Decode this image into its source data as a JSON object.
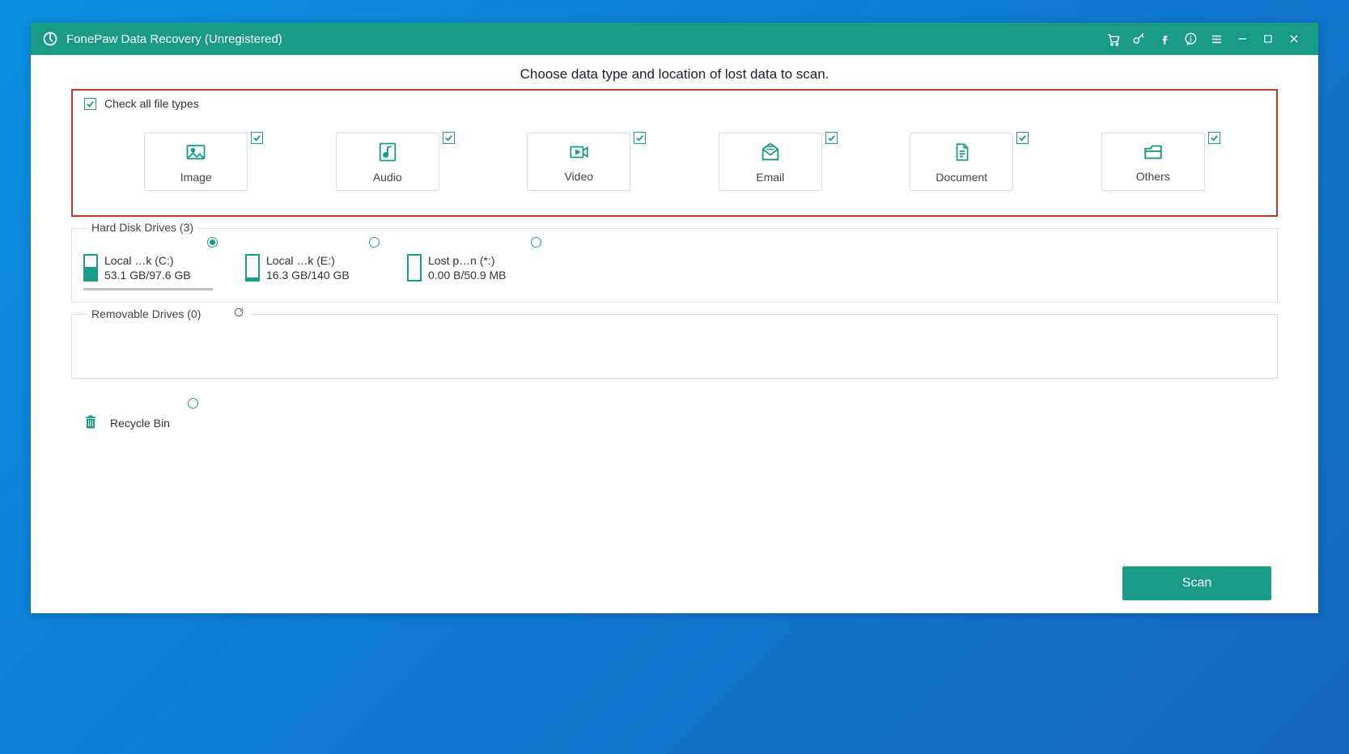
{
  "window": {
    "title": "FonePaw Data Recovery (Unregistered)"
  },
  "instruction": "Choose data type and location of lost data to scan.",
  "checkAll": {
    "label": "Check all file types",
    "checked": true
  },
  "types": [
    {
      "key": "image",
      "label": "Image",
      "checked": true
    },
    {
      "key": "audio",
      "label": "Audio",
      "checked": true
    },
    {
      "key": "video",
      "label": "Video",
      "checked": true
    },
    {
      "key": "email",
      "label": "Email",
      "checked": true
    },
    {
      "key": "document",
      "label": "Document",
      "checked": true
    },
    {
      "key": "others",
      "label": "Others",
      "checked": true
    }
  ],
  "drivesSection": {
    "label": "Hard Disk Drives (3)"
  },
  "drives": [
    {
      "key": "c",
      "name": "Local …k (C:)",
      "usage": "53.1 GB/97.6 GB",
      "fillPct": 55,
      "selected": true
    },
    {
      "key": "e",
      "name": "Local …k (E:)",
      "usage": "16.3 GB/140 GB",
      "fillPct": 12,
      "selected": false
    },
    {
      "key": "lost",
      "name": "Lost p…n (*:)",
      "usage": "0.00  B/50.9 MB",
      "fillPct": 0,
      "selected": false
    }
  ],
  "removableSection": {
    "label": "Removable Drives (0)"
  },
  "recycle": {
    "label": "Recycle Bin",
    "selected": false
  },
  "scan": {
    "label": "Scan"
  }
}
